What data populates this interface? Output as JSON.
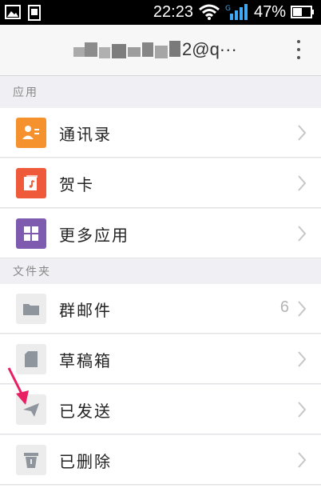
{
  "status_bar": {
    "time": "22:23",
    "battery": "47%"
  },
  "header": {
    "account": "2@q···"
  },
  "sections": {
    "apps": "应用",
    "folders": "文件夹"
  },
  "apps": [
    {
      "label": "通讯录",
      "color": "#f5922e"
    },
    {
      "label": "贺卡",
      "color": "#ef5a3a"
    },
    {
      "label": "更多应用",
      "color": "#7f5bb0"
    }
  ],
  "folders": [
    {
      "label": "群邮件",
      "count": "6"
    },
    {
      "label": "草稿箱"
    },
    {
      "label": "已发送"
    },
    {
      "label": "已删除"
    }
  ],
  "colors": {
    "annotation_arrow": "#e91e63"
  }
}
